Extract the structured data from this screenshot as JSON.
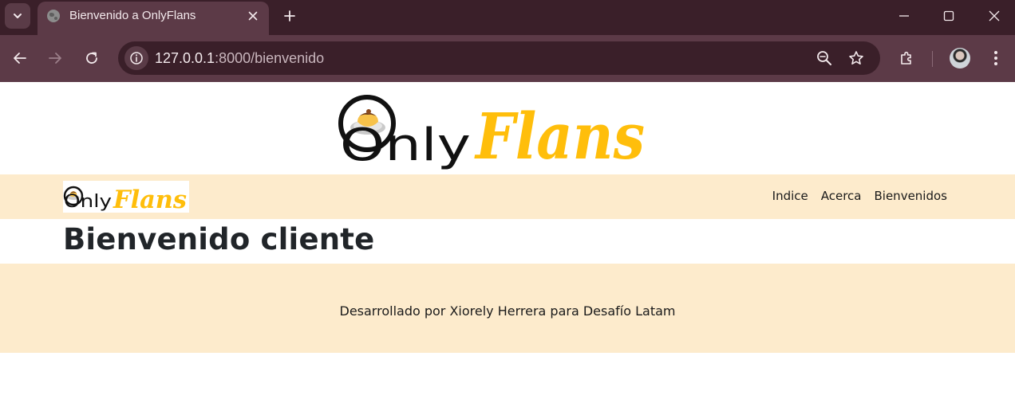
{
  "browser": {
    "tab": {
      "title": "Bienvenido a OnlyFlans",
      "favicon": "globe-icon"
    },
    "address": {
      "host": "127.0.0.1",
      "path": ":8000/bienvenido"
    },
    "theme": {
      "frame": "#3a1f29",
      "toolbar": "#5c3a47"
    }
  },
  "site": {
    "logo": {
      "word_left": "Only",
      "word_right": "Flans",
      "accent": "#ffbe0b",
      "icon": "flan-on-plate-icon"
    },
    "nav": {
      "links": [
        "Indice",
        "Acerca",
        "Bienvenidos"
      ],
      "background": "#fdebcc"
    },
    "heading": "Bienvenido cliente",
    "footer": {
      "text": "Desarrollado por Xiorely Herrera para Desafío Latam"
    }
  }
}
